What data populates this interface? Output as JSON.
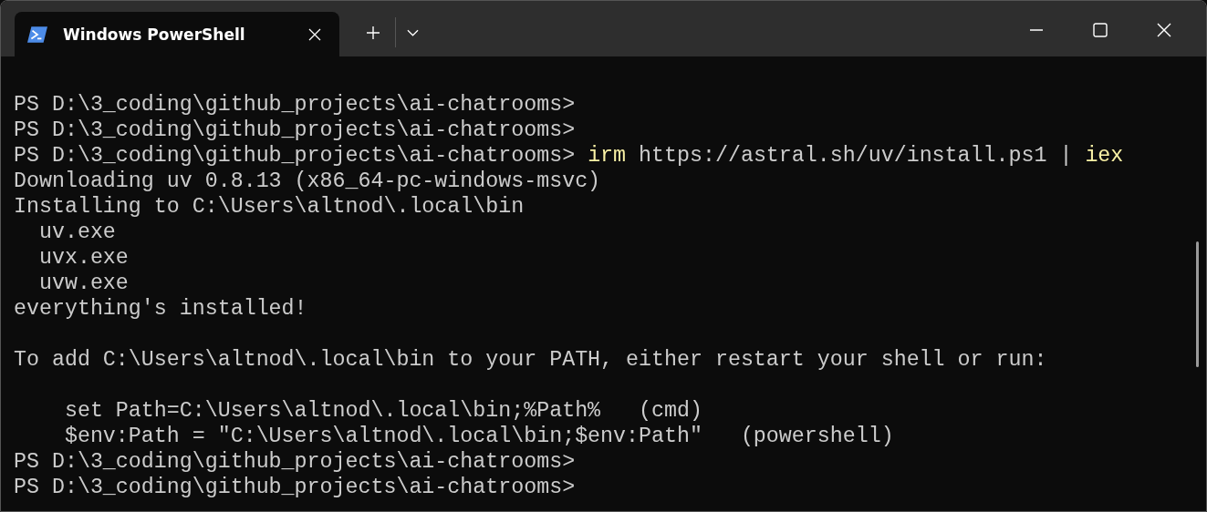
{
  "tabs": [
    {
      "title": "Windows PowerShell",
      "selected": true
    }
  ],
  "terminal": {
    "lines": [
      {
        "kind": "blank"
      },
      {
        "kind": "text",
        "segments": [
          {
            "kind": "output",
            "text": "PS D:\\3_coding\\github_projects\\ai-chatrooms>"
          }
        ]
      },
      {
        "kind": "text",
        "segments": [
          {
            "kind": "output",
            "text": "PS D:\\3_coding\\github_projects\\ai-chatrooms>"
          }
        ]
      },
      {
        "kind": "text",
        "segments": [
          {
            "kind": "output",
            "text": "PS D:\\3_coding\\github_projects\\ai-chatrooms> "
          },
          {
            "kind": "command",
            "text": "irm"
          },
          {
            "kind": "output",
            "text": " https://astral.sh/uv/install.ps1 | "
          },
          {
            "kind": "command",
            "text": "iex"
          }
        ]
      },
      {
        "kind": "text",
        "segments": [
          {
            "kind": "output",
            "text": "Downloading uv 0.8.13 (x86_64-pc-windows-msvc)"
          }
        ]
      },
      {
        "kind": "text",
        "segments": [
          {
            "kind": "output",
            "text": "Installing to C:\\Users\\altnod\\.local\\bin"
          }
        ]
      },
      {
        "kind": "text",
        "segments": [
          {
            "kind": "output",
            "text": "  uv.exe"
          }
        ]
      },
      {
        "kind": "text",
        "segments": [
          {
            "kind": "output",
            "text": "  uvx.exe"
          }
        ]
      },
      {
        "kind": "text",
        "segments": [
          {
            "kind": "output",
            "text": "  uvw.exe"
          }
        ]
      },
      {
        "kind": "text",
        "segments": [
          {
            "kind": "output",
            "text": "everything's installed!"
          }
        ]
      },
      {
        "kind": "blank"
      },
      {
        "kind": "text",
        "segments": [
          {
            "kind": "output",
            "text": "To add C:\\Users\\altnod\\.local\\bin to your PATH, either restart your shell or run:"
          }
        ]
      },
      {
        "kind": "blank"
      },
      {
        "kind": "text",
        "segments": [
          {
            "kind": "output",
            "text": "    set Path=C:\\Users\\altnod\\.local\\bin;%Path%   (cmd)"
          }
        ]
      },
      {
        "kind": "text",
        "segments": [
          {
            "kind": "output",
            "text": "    $env:Path = \"C:\\Users\\altnod\\.local\\bin;$env:Path\"   (powershell)"
          }
        ]
      },
      {
        "kind": "text",
        "segments": [
          {
            "kind": "output",
            "text": "PS D:\\3_coding\\github_projects\\ai-chatrooms>"
          }
        ]
      },
      {
        "kind": "text",
        "segments": [
          {
            "kind": "output",
            "text": "PS D:\\3_coding\\github_projects\\ai-chatrooms>"
          }
        ]
      }
    ]
  }
}
